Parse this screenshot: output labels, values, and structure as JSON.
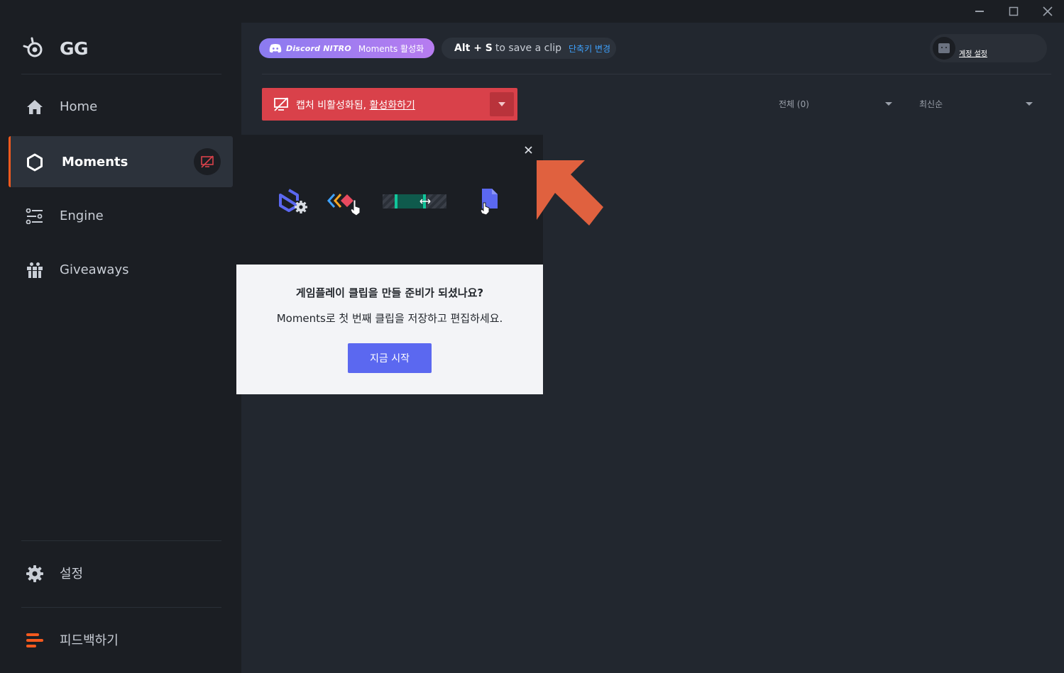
{
  "window": {
    "controls": [
      "minimize-icon",
      "maximize-icon",
      "close-icon"
    ]
  },
  "sidebar": {
    "logo_text": "GG",
    "items": [
      {
        "label": "Home",
        "icon": "home-icon"
      },
      {
        "label": "Moments",
        "icon": "hexagon-icon",
        "active": true
      },
      {
        "label": "Engine",
        "icon": "sliders-icon"
      },
      {
        "label": "Giveaways",
        "icon": "gift-icon"
      }
    ],
    "settings_label": "설정",
    "feedback_label": "피드백하기"
  },
  "header": {
    "discord_brand": "Discord NITRO",
    "discord_label": "Moments 활성화",
    "hotkey_keys": "Alt + S",
    "hotkey_text": "to save a clip",
    "hotkey_change": "단축키 변경",
    "account_label": "계정 설정"
  },
  "capture_bar": {
    "text": "캡처 비활성화됨, ",
    "link": "활성화하기"
  },
  "filters": {
    "all": "전체 (0)",
    "sort": "최신순"
  },
  "popup": {
    "title": "게임플레이 클립을 만들 준비가 되셨나요?",
    "subtitle": "Moments로 첫 번째 클립을 저장하고 편집하세요.",
    "button": "지금 시작"
  },
  "colors": {
    "accent_orange": "#f55a1e",
    "capture_red": "#d9414a",
    "discord_purple": "#8b7bf0",
    "primary_blue": "#5b68f0",
    "link_blue": "#3ea2ff",
    "arrow": "#e0613f"
  }
}
